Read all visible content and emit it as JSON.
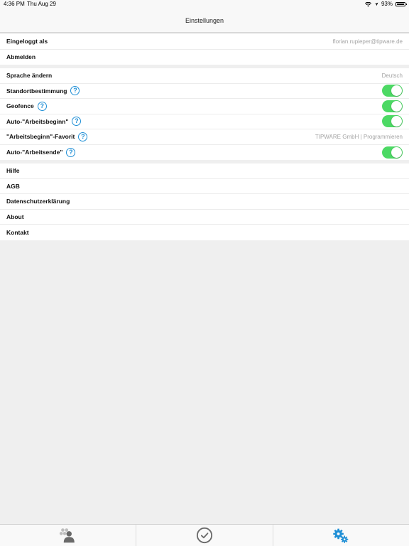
{
  "status_bar": {
    "time": "4:36 PM",
    "date": "Thu Aug 29",
    "battery": "93%"
  },
  "nav": {
    "title": "Einstellungen"
  },
  "account": {
    "logged_in_label": "Eingeloggt als",
    "logged_in_value": "florian.rupieper@tipware.de",
    "logout_label": "Abmelden"
  },
  "settings": {
    "language_label": "Sprache ändern",
    "language_value": "Deutsch",
    "location_label": "Standortbestimmung",
    "location_enabled": true,
    "geofence_label": "Geofence",
    "geofence_enabled": true,
    "auto_start_label": "Auto-\"Arbeitsbeginn\"",
    "auto_start_enabled": true,
    "favorite_label": "\"Arbeitsbeginn\"-Favorit",
    "favorite_value": "TIPWARE GmbH | Programmieren",
    "auto_end_label": "Auto-\"Arbeitsende\"",
    "auto_end_enabled": true
  },
  "info": {
    "help": "Hilfe",
    "agb": "AGB",
    "privacy": "Datenschutzerklärung",
    "about": "About",
    "contact": "Kontakt"
  },
  "help_glyph": "?",
  "colors": {
    "accent": "#1f8fd6",
    "toggle_on": "#4cd964",
    "background": "#efefef"
  },
  "tabbar": {
    "tabs": [
      {
        "icon": "users-icon",
        "active": false
      },
      {
        "icon": "clock-check-icon",
        "active": false
      },
      {
        "icon": "gears-icon",
        "active": true
      }
    ]
  }
}
